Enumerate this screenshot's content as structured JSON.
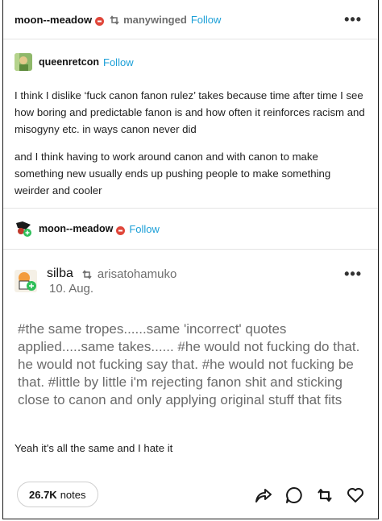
{
  "post": {
    "author": "moon--meadow",
    "reblog_from": "manywinged",
    "follow_label": "Follow",
    "menu_label": "•••"
  },
  "reblog1": {
    "author": "queenretcon",
    "follow_label": "Follow",
    "paragraphs": [
      "I think I dislike ‘fuck canon fanon rulez’ takes because time after time I see how boring and predictable fanon is and how often it reinforces racism and misogyny etc. in ways canon never did",
      "and I think having to work around canon and with canon to make something new usually ends up pushing people to make something weirder and cooler"
    ]
  },
  "reblog2": {
    "author": "moon--meadow",
    "follow_label": "Follow"
  },
  "reblog3": {
    "author": "silba",
    "reblog_from": "arisatohamuko",
    "date": "10. Aug.",
    "menu_label": "•••",
    "tags": "#the same tropes......same 'incorrect' quotes applied.....same takes......  #he would not fucking do that. he would not fucking say that.  #he would not fucking be that.  #little by little i'm rejecting fanon shit and sticking close to canon and only applying original stuff that fits",
    "comment": "Yeah it's all the same and I hate it"
  },
  "footer": {
    "notes_count": "26.7K",
    "notes_label": "notes"
  },
  "colors": {
    "accent": "#1b9fd7",
    "badge": "#e0473b",
    "reblog_green": "#2fbf59"
  }
}
